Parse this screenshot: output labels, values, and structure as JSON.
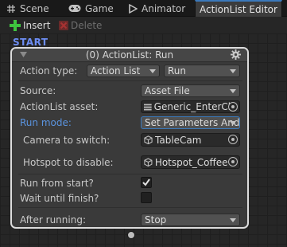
{
  "tabs": [
    {
      "label": "Scene",
      "icon": "grid-icon"
    },
    {
      "label": "Game",
      "icon": "gamepad-icon"
    },
    {
      "label": "Animator",
      "icon": "animator-icon"
    },
    {
      "label": "ActionList Editor",
      "icon": null
    }
  ],
  "active_tab": "ActionList Editor",
  "toolbar": {
    "insert_label": "Insert",
    "delete_label": "Delete"
  },
  "canvas": {
    "start_label": "START"
  },
  "node": {
    "title": "(0) ActionList: Run",
    "action_type_label": "Action type:",
    "action_type_category": "Action List",
    "action_type_action": "Run",
    "source_label": "Source:",
    "source_value": "Asset File",
    "actionlist_asset_label": "ActionList asset:",
    "actionlist_asset_value": "Generic_EnterClo",
    "run_mode_label": "Run mode:",
    "run_mode_value": "Set Parameters And",
    "camera_label": "Camera to switch:",
    "camera_value": "TableCam",
    "hotspot_label": "Hotspot to disable:",
    "hotspot_value": "Hotspot_Coffee",
    "run_from_start_label": "Run from start?",
    "run_from_start_checked": true,
    "wait_until_finish_label": "Wait until finish?",
    "wait_until_finish_checked": false,
    "after_running_label": "After running:",
    "after_running_value": "Stop"
  },
  "colors": {
    "accent": "#3a79bb",
    "start": "#6d8ef5",
    "run_mode_label": "#5a93de",
    "insert_plus": "#3ec43e",
    "delete_x": "#a83232"
  }
}
